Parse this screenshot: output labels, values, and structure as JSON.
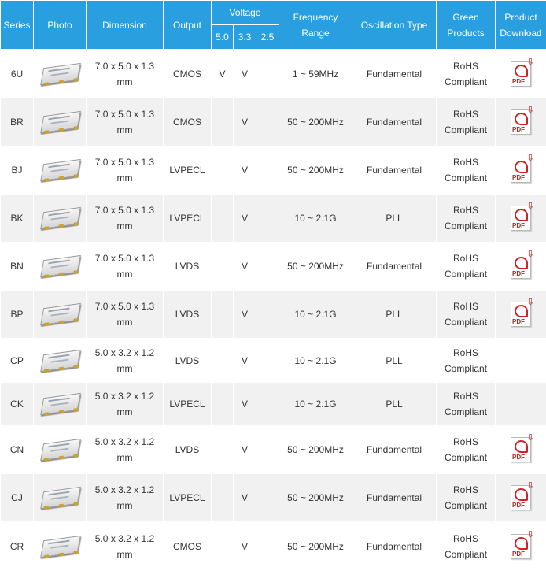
{
  "header": {
    "series": "Series",
    "photo": "Photo",
    "dimension": "Dimension",
    "output": "Output",
    "voltage": "Voltage",
    "v50": "5.0",
    "v33": "3.3",
    "v25": "2.5",
    "freq_line1": "Frequency",
    "freq_line2": "Range",
    "osc_type": "Oscillation Type",
    "green_line1": "Green",
    "green_line2": "Products",
    "product_line1": "Product",
    "product_line2": "Download"
  },
  "rows": [
    {
      "series": "6U",
      "dim1": "7.0 x 5.0 x 1.3",
      "dim2": "mm",
      "output": "CMOS",
      "v50": "V",
      "v33": "V",
      "v25": "",
      "freq": "1 ~ 59MHz",
      "osc": "Fundamental",
      "green1": "RoHS",
      "green2": "Compliant",
      "pdf": true
    },
    {
      "series": "BR",
      "dim1": "7.0 x 5.0 x 1.3",
      "dim2": "mm",
      "output": "CMOS",
      "v50": "",
      "v33": "V",
      "v25": "",
      "freq": "50 ~ 200MHz",
      "osc": "Fundamental",
      "green1": "RoHS",
      "green2": "Compliant",
      "pdf": true
    },
    {
      "series": "BJ",
      "dim1": "7.0 x 5.0 x 1.3",
      "dim2": "mm",
      "output": "LVPECL",
      "v50": "",
      "v33": "V",
      "v25": "",
      "freq": "50 ~ 200MHz",
      "osc": "Fundamental",
      "green1": "RoHS",
      "green2": "Compliant",
      "pdf": true
    },
    {
      "series": "BK",
      "dim1": "7.0 x 5.0 x 1.3",
      "dim2": "mm",
      "output": "LVPECL",
      "v50": "",
      "v33": "V",
      "v25": "",
      "freq": "10 ~ 2.1G",
      "osc": "PLL",
      "green1": "RoHS",
      "green2": "Compliant",
      "pdf": true
    },
    {
      "series": "BN",
      "dim1": "7.0 x 5.0 x 1.3",
      "dim2": "mm",
      "output": "LVDS",
      "v50": "",
      "v33": "V",
      "v25": "",
      "freq": "50 ~ 200MHz",
      "osc": "Fundamental",
      "green1": "RoHS",
      "green2": "Compliant",
      "pdf": true
    },
    {
      "series": "BP",
      "dim1": "7.0 x 5.0 x 1.3",
      "dim2": "mm",
      "output": "LVDS",
      "v50": "",
      "v33": "V",
      "v25": "",
      "freq": "10 ~ 2.1G",
      "osc": "PLL",
      "green1": "RoHS",
      "green2": "Compliant",
      "pdf": true
    },
    {
      "series": "CP",
      "dim1": "5.0 x 3.2 x 1.2",
      "dim2": "mm",
      "output": "LVDS",
      "v50": "",
      "v33": "V",
      "v25": "",
      "freq": "10 ~ 2.1G",
      "osc": "PLL",
      "green1": "RoHS",
      "green2": "Compliant",
      "pdf": false
    },
    {
      "series": "CK",
      "dim1": "5.0 x 3.2 x 1.2",
      "dim2": "mm",
      "output": "LVPECL",
      "v50": "",
      "v33": "V",
      "v25": "",
      "freq": "10 ~ 2.1G",
      "osc": "PLL",
      "green1": "RoHS",
      "green2": "Compliant",
      "pdf": false
    },
    {
      "series": "CN",
      "dim1": "5.0 x 3.2 x 1.2",
      "dim2": "mm",
      "output": "LVDS",
      "v50": "",
      "v33": "V",
      "v25": "",
      "freq": "50 ~ 200MHz",
      "osc": "Fundamental",
      "green1": "RoHS",
      "green2": "Compliant",
      "pdf": true
    },
    {
      "series": "CJ",
      "dim1": "5.0 x 3.2 x 1.2",
      "dim2": "mm",
      "output": "LVPECL",
      "v50": "",
      "v33": "V",
      "v25": "",
      "freq": "50 ~ 200MHz",
      "osc": "Fundamental",
      "green1": "RoHS",
      "green2": "Compliant",
      "pdf": true
    },
    {
      "series": "CR",
      "dim1": "5.0 x 3.2 x 1.2",
      "dim2": "mm",
      "output": "CMOS",
      "v50": "",
      "v33": "V",
      "v25": "",
      "freq": "50 ~ 200MHz",
      "osc": "Fundamental",
      "green1": "RoHS",
      "green2": "Compliant",
      "pdf": true
    }
  ],
  "pdf_icon": {
    "label": "PDF",
    "arrow": "⇩"
  },
  "colors": {
    "header_bg": "#2a9fe0",
    "row_alt_bg": "#f1f1f1",
    "pdf_red": "#d02424"
  }
}
